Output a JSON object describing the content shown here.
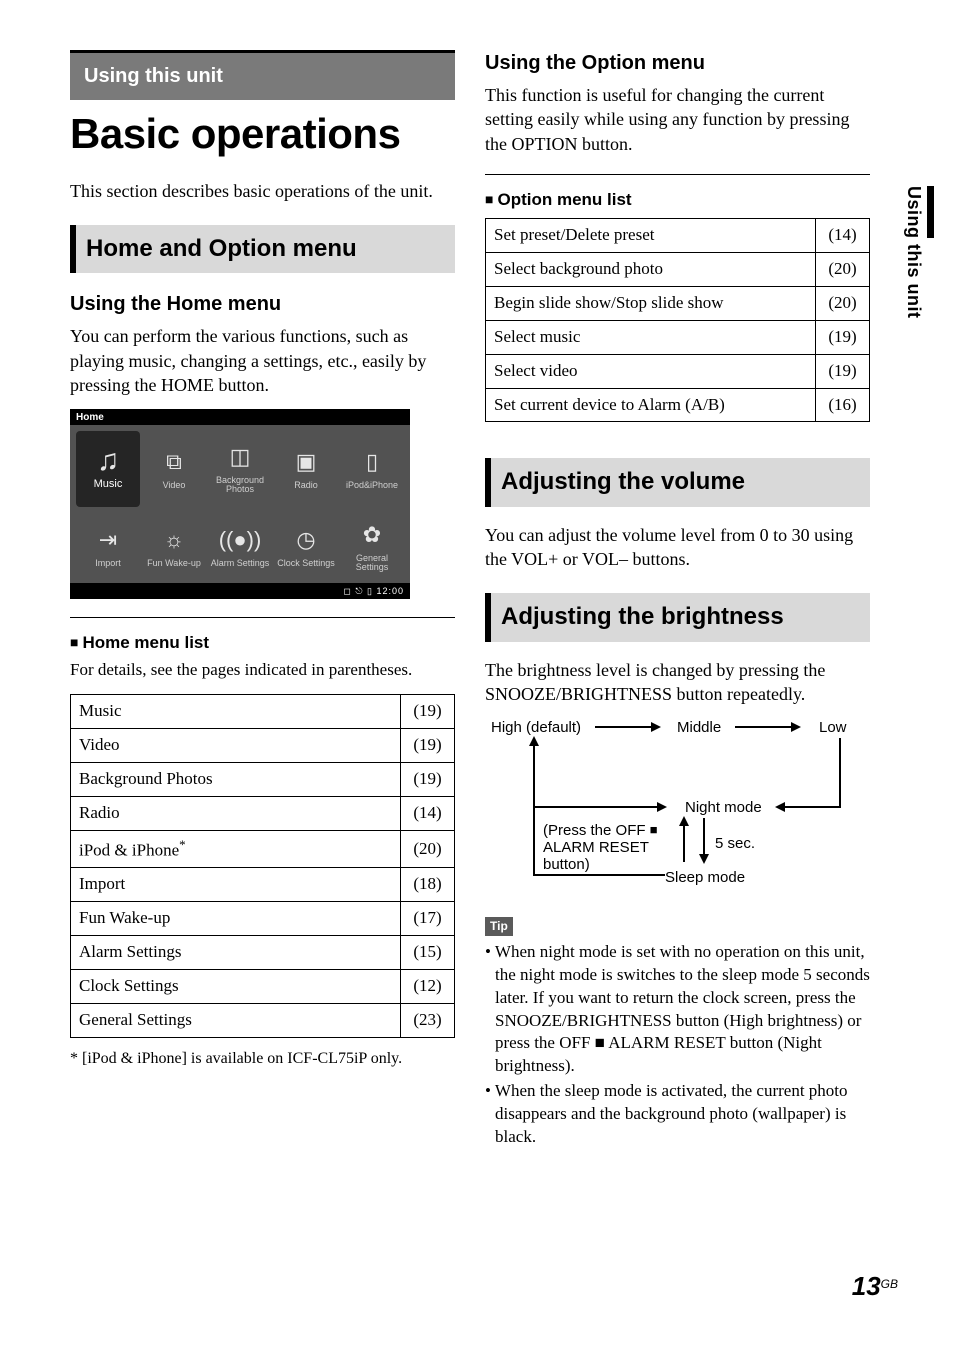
{
  "side_tab": "Using this unit",
  "section_tag": "Using this unit",
  "title": "Basic operations",
  "intro": "This section describes basic operations of the unit.",
  "h2_home_option": "Home and Option menu",
  "h3_using_home": "Using the Home menu",
  "p_using_home": "You can perform the various functions, such as playing music, changing a settings, etc., easily by pressing the HOME button.",
  "home_screen": {
    "bar_title": "Home",
    "cells": [
      {
        "icon": "♫",
        "label": "Music",
        "selected": true
      },
      {
        "icon": "⧉",
        "label": "Video"
      },
      {
        "icon": "◫",
        "label": "Background\nPhotos"
      },
      {
        "icon": "▣",
        "label": "Radio"
      },
      {
        "icon": "▯",
        "label": "iPod&iPhone"
      },
      {
        "icon": "⇥",
        "label": "Import"
      },
      {
        "icon": "☼",
        "label": "Fun Wake-up"
      },
      {
        "icon": "((●))",
        "label": "Alarm\nSettings"
      },
      {
        "icon": "◷",
        "label": "Clock\nSettings"
      },
      {
        "icon": "✿",
        "label": "General\nSettings"
      }
    ],
    "footer": "◻ ⎋ ▯ 12:00"
  },
  "home_list_head": "Home menu list",
  "home_list_sub": "For details, see the pages indicated in parentheses.",
  "home_list": [
    {
      "name": "Music",
      "page": "(19)"
    },
    {
      "name": "Video",
      "page": "(19)"
    },
    {
      "name": "Background Photos",
      "page": "(19)"
    },
    {
      "name": "Radio",
      "page": "(14)"
    },
    {
      "name": "iPod & iPhone*",
      "page": "(20)",
      "ast": true
    },
    {
      "name": "Import",
      "page": "(18)"
    },
    {
      "name": "Fun Wake-up",
      "page": "(17)"
    },
    {
      "name": "Alarm Settings",
      "page": "(15)"
    },
    {
      "name": "Clock Settings",
      "page": "(12)"
    },
    {
      "name": "General Settings",
      "page": "(23)"
    }
  ],
  "home_footnote": "*  [iPod & iPhone] is available on ICF-CL75iP only.",
  "h3_using_option": "Using the Option menu",
  "p_using_option": "This function is useful for changing the current setting easily while using any function by pressing the OPTION button.",
  "option_list_head": "Option menu list",
  "option_list": [
    {
      "name": "Set preset/Delete preset",
      "page": "(14)"
    },
    {
      "name": "Select background photo",
      "page": "(20)"
    },
    {
      "name": "Begin slide show/Stop slide show",
      "page": "(20)"
    },
    {
      "name": "Select music",
      "page": "(19)"
    },
    {
      "name": "Select video",
      "page": "(19)"
    },
    {
      "name": "Set current device to Alarm (A/B)",
      "page": "(16)"
    }
  ],
  "h2_volume": "Adjusting the volume",
  "p_volume": "You can adjust the volume level from 0 to 30 using the VOL+ or VOL– buttons.",
  "h2_brightness": "Adjusting the brightness",
  "p_brightness": "The brightness level is changed by pressing the SNOOZE/BRIGHTNESS button repeatedly.",
  "bd": {
    "high": "High (default)",
    "middle": "Middle",
    "low": "Low",
    "night": "Night mode",
    "press_off_1": "(Press the OFF",
    "press_off_2": "ALARM RESET",
    "press_off_3": "button)",
    "five_sec": "5 sec.",
    "sleep": "Sleep mode"
  },
  "tip_label": "Tip",
  "tips": [
    "When night mode is set with no operation on this unit, the night mode is switches to the sleep mode 5 seconds later. If you want to return the clock screen, press the SNOOZE/BRIGHTNESS button (High brightness) or press the OFF ■ ALARM RESET button (Night brightness).",
    "When the sleep mode is activated, the current photo disappears and the background photo (wallpaper) is black."
  ],
  "page_number": "13",
  "page_gb": "GB"
}
